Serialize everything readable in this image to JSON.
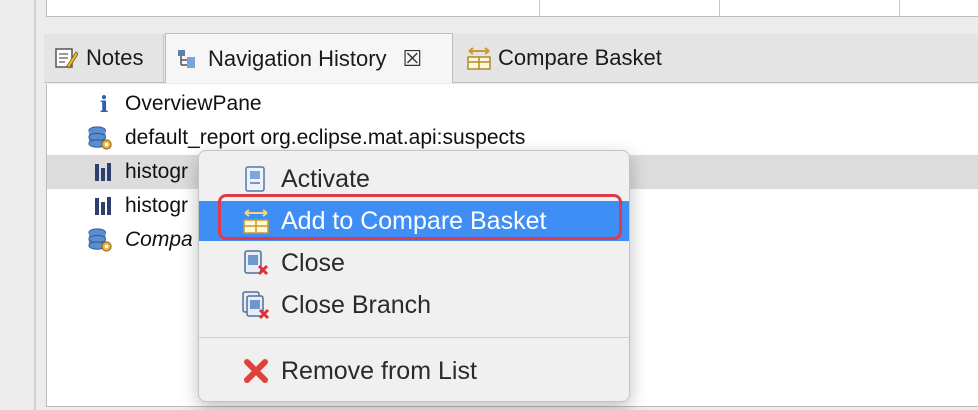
{
  "tabs": [
    {
      "label": "Notes",
      "icon": "notes-icon"
    },
    {
      "label": "Navigation History",
      "icon": "navigation-history-icon",
      "active": true,
      "close": "☒"
    },
    {
      "label": "Compare Basket",
      "icon": "compare-basket-icon"
    }
  ],
  "history": [
    {
      "label": "OverviewPane",
      "icon": "info-icon",
      "italic": false
    },
    {
      "label": "default_report  org.eclipse.mat.api:suspects",
      "icon": "heap-dump-icon",
      "italic": false
    },
    {
      "label": "histogr",
      "icon": "histogram-icon",
      "italic": false,
      "selected": true
    },
    {
      "label": "histogr",
      "icon": "histogram-icon",
      "italic": false
    },
    {
      "label": "Compa",
      "icon": "heap-dump-icon",
      "italic": true
    }
  ],
  "menu": {
    "items": [
      {
        "label": "Activate",
        "icon": "activate-icon"
      },
      {
        "label": "Add to Compare Basket",
        "icon": "compare-basket-icon",
        "highlighted": true
      },
      {
        "label": "Close",
        "icon": "close-editor-icon"
      },
      {
        "label": "Close Branch",
        "icon": "close-branch-icon"
      },
      {
        "label": "Remove from List",
        "icon": "remove-icon"
      }
    ]
  },
  "colors": {
    "menu_highlight": "#3f8ef6",
    "annotation_frame": "#e03a4a",
    "selected_row": "#dcdcdc"
  }
}
